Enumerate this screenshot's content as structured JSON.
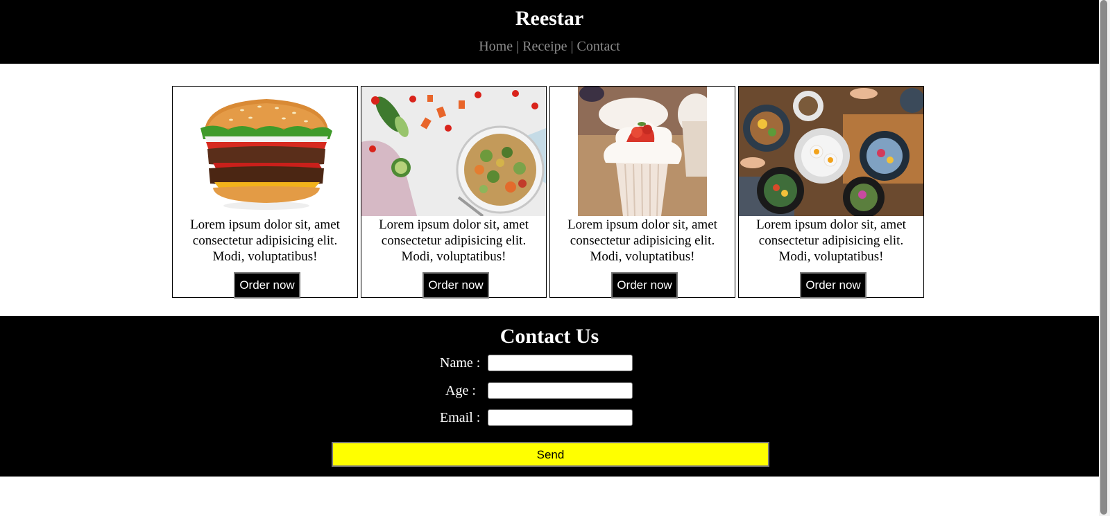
{
  "header": {
    "title": "Reestar",
    "nav": [
      {
        "label": "Home"
      },
      {
        "label": "Receipe"
      },
      {
        "label": "Contact"
      }
    ],
    "separator": "|"
  },
  "cards": [
    {
      "image": "burger",
      "description": "Lorem ipsum dolor sit, amet consectetur adipisicing elit. Modi, voluptatibus!",
      "button": "Order now"
    },
    {
      "image": "salad-bowl",
      "description": "Lorem ipsum dolor sit, amet consectetur adipisicing elit. Modi, voluptatibus!",
      "button": "Order now"
    },
    {
      "image": "cupcake",
      "description": "Lorem ipsum dolor sit, amet consectetur adipisicing elit. Modi, voluptatibus!",
      "button": "Order now"
    },
    {
      "image": "food-table",
      "description": "Lorem ipsum dolor sit, amet consectetur adipisicing elit. Modi, voluptatibus!",
      "button": "Order now"
    }
  ],
  "contact": {
    "title": "Contact Us",
    "fields": [
      {
        "label": "Name :",
        "value": ""
      },
      {
        "label": "Age :",
        "value": ""
      },
      {
        "label": "Email :",
        "value": ""
      }
    ],
    "send_label": "Send"
  },
  "colors": {
    "header_bg": "#000000",
    "nav_text": "#8c8c8c",
    "send_button": "#ffff00"
  }
}
